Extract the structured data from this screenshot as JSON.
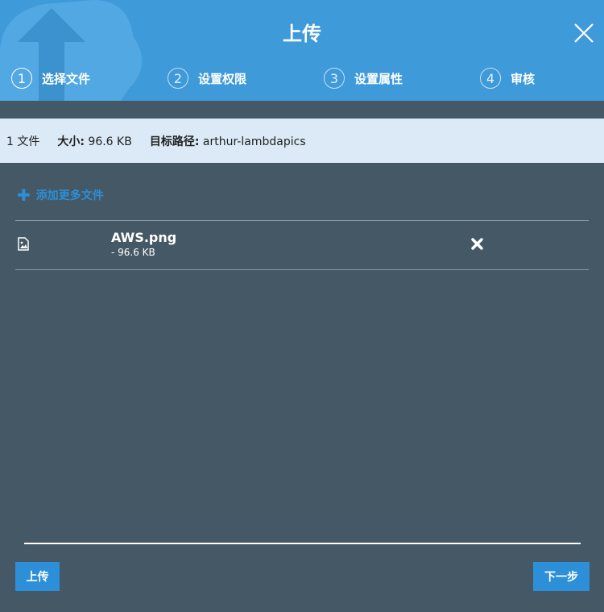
{
  "dialog": {
    "title": "上传",
    "close_icon": "close-icon",
    "background_logo_icon": "cloud-upload-icon"
  },
  "steps": [
    {
      "number": "1",
      "label": "选择文件",
      "active": true
    },
    {
      "number": "2",
      "label": "设置权限",
      "active": false
    },
    {
      "number": "3",
      "label": "设置属性",
      "active": false
    },
    {
      "number": "4",
      "label": "审核",
      "active": false
    }
  ],
  "summary": {
    "file_count": "1 文件",
    "size_label": "大小:",
    "size_value": "96.6 KB",
    "target_label": "目标路径:",
    "target_value": "arthur-lambdapics"
  },
  "add_more": {
    "icon": "plus-icon",
    "label": "添加更多文件"
  },
  "files": [
    {
      "icon": "image-file-icon",
      "name": "AWS.png",
      "size": "- 96.6 KB",
      "remove_icon": "remove-icon"
    }
  ],
  "footer": {
    "upload_label": "上传",
    "next_label": "下一步"
  },
  "colors": {
    "header": "#3f9ada",
    "body": "#445865",
    "info_bar": "#dbeaf6",
    "accent": "#2d8fd8"
  }
}
